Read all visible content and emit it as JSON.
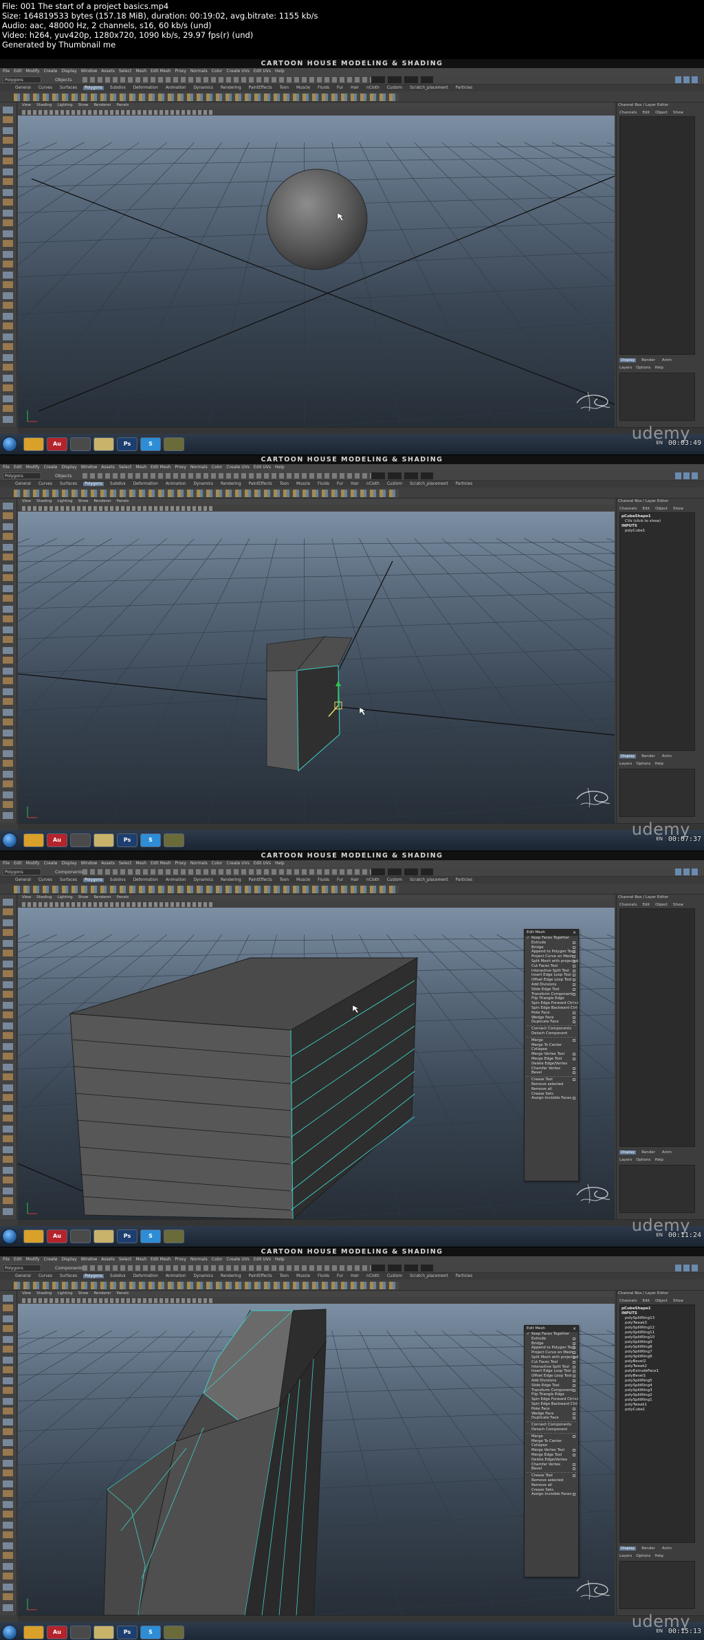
{
  "header": {
    "lines": [
      "File: 001 The start of a project basics.mp4",
      "Size: 164819533 bytes (157.18 MiB), duration: 00:19:02, avg.bitrate: 1155 kb/s",
      "Audio: aac, 48000 Hz, 2 channels, s16, 60 kb/s (und)",
      "Video: h264, yuv420p, 1280x720, 1090 kb/s, 29.97 fps(r) (und)",
      "Generated by Thumbnail me"
    ]
  },
  "common": {
    "title": "CARTOON HOUSE MODELING & SHADING",
    "menubar": [
      "File",
      "Edit",
      "Modify",
      "Create",
      "Display",
      "Window",
      "Assets",
      "Select",
      "Mesh",
      "Edit Mesh",
      "Proxy",
      "Normals",
      "Color",
      "Create UVs",
      "Edit UVs",
      "Help"
    ],
    "shelf_tabs": [
      "General",
      "Curves",
      "Surfaces",
      "Polygons",
      "Subdivs",
      "Deformation",
      "Animation",
      "Dynamics",
      "Rendering",
      "PaintEffects",
      "Toon",
      "Muscle",
      "Fluids",
      "Fur",
      "Hair",
      "nCloth",
      "Custom",
      "Scratch_placement",
      "Particles"
    ],
    "active_shelf_tab": "Polygons",
    "panel_menu": [
      "View",
      "Shading",
      "Lighting",
      "Show",
      "Renderer",
      "Panels"
    ],
    "mode_select": "Polygons",
    "right_panel_title": "Channel Box / Layer Editor",
    "right_panel_tabs": [
      "Channels",
      "Edit",
      "Object",
      "Show"
    ],
    "layer_tabs": [
      "Display",
      "Render",
      "Anim"
    ],
    "layer_menu": [
      "Layers",
      "Options",
      "Help"
    ],
    "taskbar_apps": [
      "",
      "Au",
      "",
      "",
      "Ps",
      "S",
      ""
    ],
    "tray_text": "EN",
    "watermark_text": "udemy",
    "accent_color": "#5f7896",
    "selection_color": "#3fd3c6"
  },
  "frames": [
    {
      "selection_mode": "Objects",
      "timestamp": "00:03:49",
      "channels": [],
      "edit_mesh_menu": false
    },
    {
      "selection_mode": "Objects",
      "timestamp": "00:07:37",
      "channels": [
        "pCubeShape1",
        "CVs (click to show)",
        "INPUTS",
        "polyCube1"
      ],
      "edit_mesh_menu": false
    },
    {
      "selection_mode": "Components",
      "timestamp": "00:11:24",
      "channels": [],
      "edit_mesh_menu": true
    },
    {
      "selection_mode": "Components",
      "timestamp": "00:15:13",
      "channels": [
        "pCubeShape1",
        "INPUTS",
        "polySplitRing13",
        "polyTweak3",
        "polySplitRing12",
        "polySplitRing11",
        "polySplitRing10",
        "polySplitRing9",
        "polySplitRing8",
        "polySplitRing7",
        "polySplitRing6",
        "polyBevel2",
        "polyTweak2",
        "polyExtrudeFace1",
        "polyBevel1",
        "polySplitRing5",
        "polySplitRing4",
        "polySplitRing3",
        "polySplitRing2",
        "polySplitRing1",
        "polyTweak1",
        "polyCube1"
      ],
      "edit_mesh_menu": true
    }
  ],
  "edit_mesh_menu": {
    "title": "Edit Mesh",
    "items": [
      {
        "label": "Keep Faces Together",
        "check": true
      },
      {
        "label": "Extrude",
        "opt": true
      },
      {
        "label": "Bridge",
        "opt": true
      },
      {
        "label": "Append to Polygon Tool",
        "opt": true
      },
      {
        "label": "Project Curve on Mesh",
        "opt": true
      },
      {
        "label": "Split Mesh with projected curve",
        "opt": true
      },
      {
        "label": "Cut Faces Tool",
        "opt": true
      },
      {
        "label": "Interactive Split Tool",
        "opt": true
      },
      {
        "label": "Insert Edge Loop Tool",
        "opt": true
      },
      {
        "label": "Offset Edge Loop Tool",
        "opt": true
      },
      {
        "label": "Add Divisions",
        "opt": true
      },
      {
        "label": "Slide Edge Tool",
        "opt": true
      },
      {
        "label": "Transform Component",
        "opt": true
      },
      {
        "label": "Flip Triangle Edge"
      },
      {
        "label": "Spin Edge Forward  Ctrl+Alt+Right"
      },
      {
        "label": "Spin Edge Backward  Ctrl+Alt+Left"
      },
      {
        "label": "Poke Face",
        "opt": true
      },
      {
        "label": "Wedge Face",
        "opt": true
      },
      {
        "label": "Duplicate Face",
        "opt": true
      },
      {
        "label": "Connect Components",
        "sep": true
      },
      {
        "label": "Detach Component"
      },
      {
        "label": "Merge",
        "opt": true,
        "sep": true
      },
      {
        "label": "Merge To Center"
      },
      {
        "label": "Collapse"
      },
      {
        "label": "Merge Vertex Tool",
        "opt": true
      },
      {
        "label": "Merge Edge Tool",
        "opt": true
      },
      {
        "label": "Delete Edge/Vertex"
      },
      {
        "label": "Chamfer Vertex",
        "opt": true
      },
      {
        "label": "Bevel",
        "opt": true
      },
      {
        "label": "Crease Tool",
        "opt": true,
        "sep": true
      },
      {
        "label": "Remove selected"
      },
      {
        "label": "Remove all"
      },
      {
        "label": "Crease Sets"
      },
      {
        "label": "Assign Invisible Faces",
        "opt": true
      }
    ]
  }
}
